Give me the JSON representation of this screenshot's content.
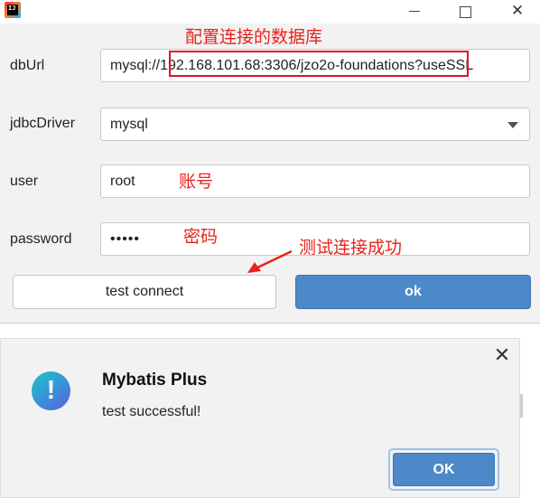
{
  "window": {
    "app_icon_text": "IJ",
    "controls": {
      "minimize": "minimize",
      "maximize": "maximize",
      "close": "✕"
    }
  },
  "annotations": {
    "db": "配置连接的数据库",
    "account": "账号",
    "password": "密码",
    "test": "测试连接成功",
    "color": "#e8221a"
  },
  "form": {
    "dburl": {
      "label": "dbUrl",
      "prefix": "mysql://",
      "highlighted": "192.168.101.68:3306/jzo2o-foundations?",
      "suffix": "useSSL"
    },
    "driver": {
      "label": "jdbcDriver",
      "value": "mysql"
    },
    "user": {
      "label": "user",
      "value": "root"
    },
    "password": {
      "label": "password",
      "value": "•••••"
    }
  },
  "buttons": {
    "test_connect": "test connect",
    "ok": "ok"
  },
  "popup": {
    "icon": "!",
    "title": "Mybatis Plus",
    "message": "test successful!",
    "ok": "OK",
    "close": "✕"
  },
  "colors": {
    "accent": "#4d88c8",
    "annotation": "#e0141e"
  }
}
